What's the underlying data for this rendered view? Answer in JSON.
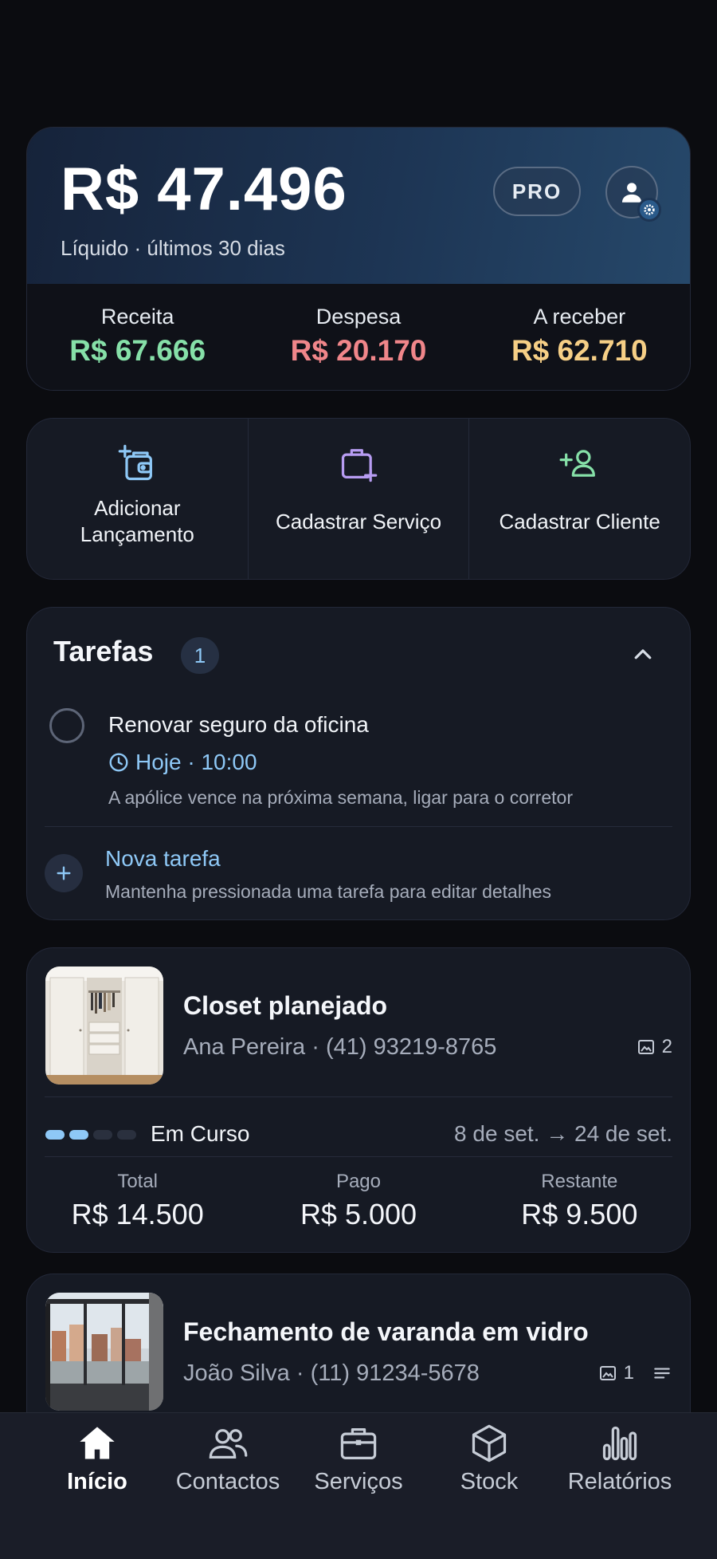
{
  "summary": {
    "balance": "R$ 47.496",
    "subtitle": "Líquido · últimos 30 dias",
    "plan_badge": "PRO",
    "stats": [
      {
        "label": "Receita",
        "value": "R$ 67.666",
        "color": "#86e0a8"
      },
      {
        "label": "Despesa",
        "value": "R$ 20.170",
        "color": "#f0868a"
      },
      {
        "label": "A receber",
        "value": "R$ 62.710",
        "color": "#f6cf86"
      }
    ]
  },
  "actions": [
    {
      "label": "Adicionar Lançamento",
      "icon": "wallet-plus-icon",
      "color": "#8ec8f6"
    },
    {
      "label": "Cadastrar Serviço",
      "icon": "briefcase-plus-icon",
      "color": "#b79cf2"
    },
    {
      "label": "Cadastrar Cliente",
      "icon": "user-plus-icon",
      "color": "#86e0a8"
    }
  ],
  "tasks": {
    "title": "Tarefas",
    "count": "1",
    "items": [
      {
        "title": "Renovar seguro da oficina",
        "time": "Hoje · 10:00",
        "description": "A apólice vence na próxima semana, ligar para o corretor"
      }
    ],
    "new_task_label": "Nova tarefa",
    "new_task_hint": "Mantenha pressionada uma tarefa para editar detalhes"
  },
  "services": [
    {
      "title": "Closet planejado",
      "client": "Ana Pereira",
      "phone": "(41) 93219-8765",
      "photos": "2",
      "status": "Em Curso",
      "progress_steps": 2,
      "progress_total": 4,
      "dates": "8 de set. → 24 de set.",
      "money": [
        {
          "label": "Total",
          "value": "R$ 14.500"
        },
        {
          "label": "Pago",
          "value": "R$ 5.000"
        },
        {
          "label": "Restante",
          "value": "R$ 9.500"
        }
      ]
    },
    {
      "title": "Fechamento de varanda em vidro",
      "client": "João Silva",
      "phone": "(11) 91234-5678",
      "photos": "1"
    }
  ],
  "nav": [
    {
      "label": "Início",
      "icon": "home-icon",
      "active": true
    },
    {
      "label": "Contactos",
      "icon": "people-icon"
    },
    {
      "label": "Serviços",
      "icon": "briefcase-icon"
    },
    {
      "label": "Stock",
      "icon": "box-icon"
    },
    {
      "label": "Relatórios",
      "icon": "bar-chart-icon"
    }
  ]
}
